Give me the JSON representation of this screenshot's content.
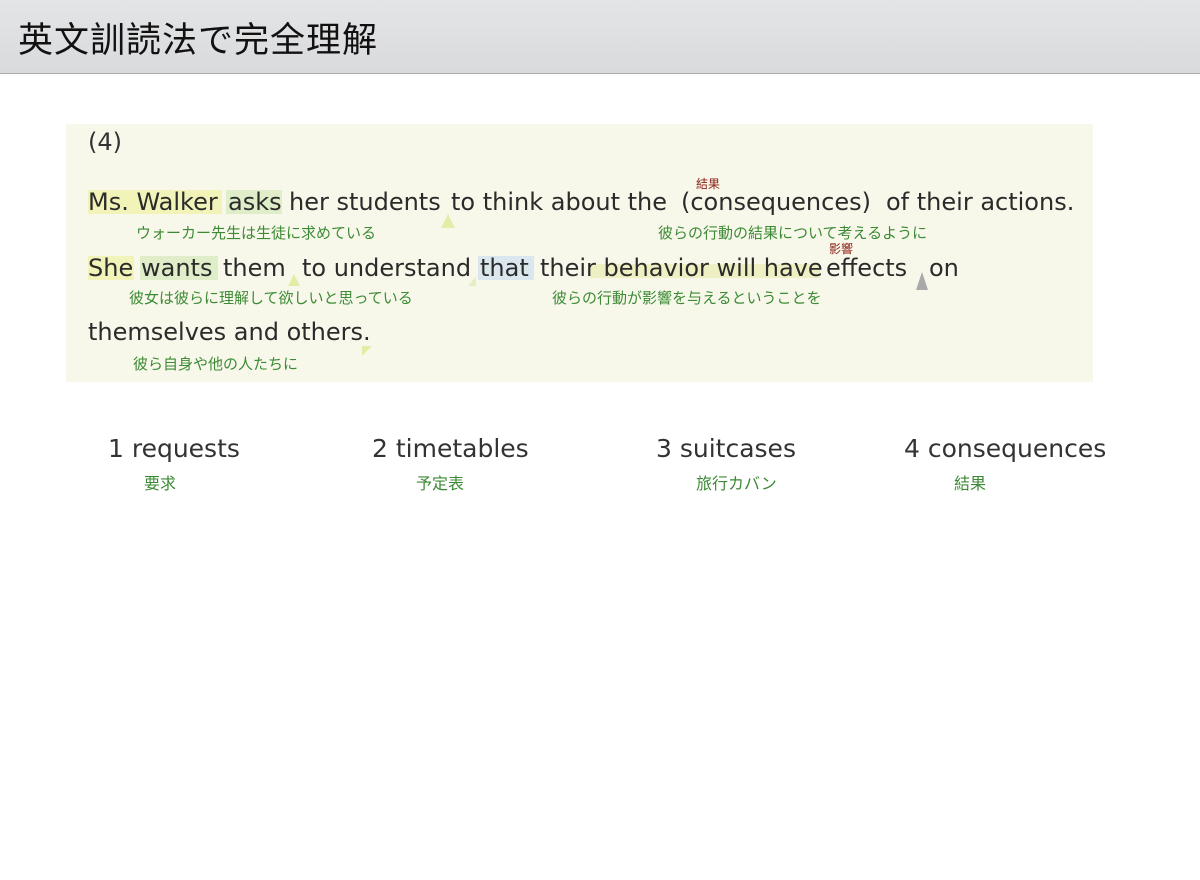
{
  "header": {
    "title": "英文訓読法で完全理解"
  },
  "question": {
    "number": "(4)",
    "line1": {
      "w1": "Ms. Walker",
      "w2": "asks",
      "w3": "her students",
      "w4": "to think about the",
      "w5": "(consequences)",
      "w6": "of their actions."
    },
    "line2": {
      "w1": "She",
      "w2": "wants",
      "w3": "them",
      "w4": "to understand",
      "w5": "that",
      "w6": "their behavior will have",
      "w7": "effects",
      "w8": "on"
    },
    "line3": {
      "w1": "themselves and others."
    },
    "glosses": {
      "g1": "ウォーカー先生は生徒に求めている",
      "g2": "彼らの行動の結果について考えるように",
      "g3": "彼女は彼らに理解して欲しいと思っている",
      "g4": "彼らの行動が影響を与えるということを",
      "g5": "彼ら自身や他の人たちに"
    },
    "ruby": {
      "r1": "結果",
      "r2": "影響"
    }
  },
  "choices": [
    {
      "label": "1 requests",
      "gloss": "要求"
    },
    {
      "label": "2 timetables",
      "gloss": "予定表"
    },
    {
      "label": "3 suitcases",
      "gloss": "旅行カバン"
    },
    {
      "label": "4 consequences",
      "gloss": "結果"
    }
  ]
}
